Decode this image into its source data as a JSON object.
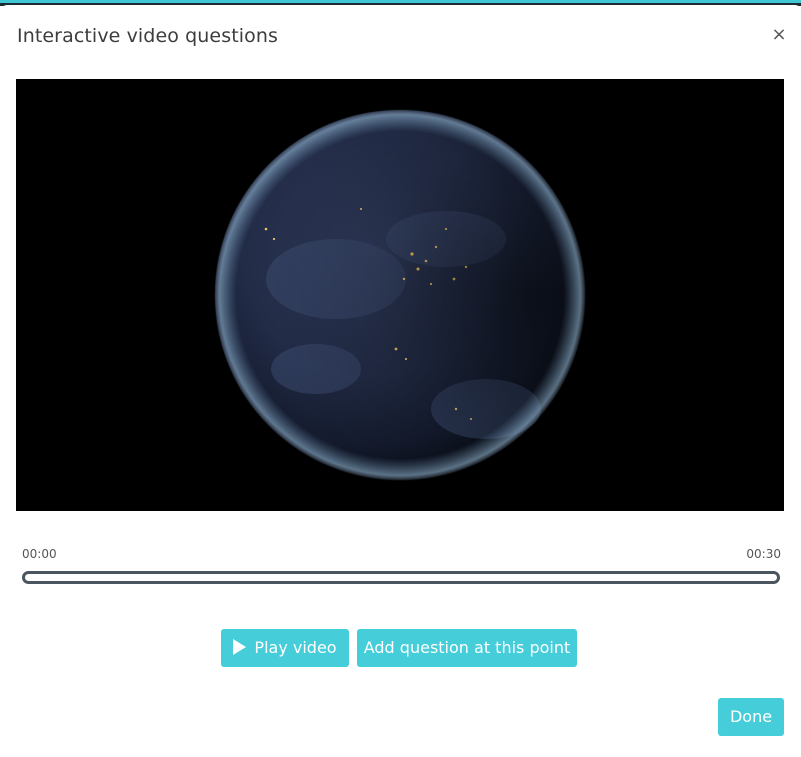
{
  "modal": {
    "title": "Interactive video questions",
    "close_label": "×"
  },
  "player": {
    "time_start": "00:00",
    "time_end": "00:30",
    "progress": 0
  },
  "actions": {
    "play_label": "Play video",
    "add_question_label": "Add question at this point",
    "done_label": "Done"
  },
  "colors": {
    "accent": "#45cdd9",
    "timeline_border": "#4a5560",
    "video_background": "#000000"
  },
  "icons": {
    "close": "close-icon",
    "play": "play-icon"
  }
}
